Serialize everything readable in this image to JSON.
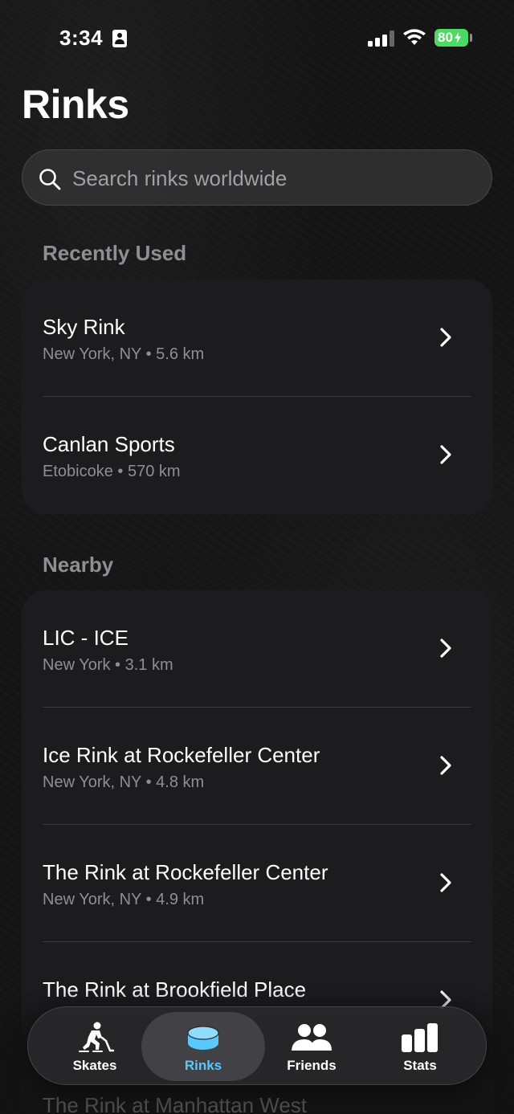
{
  "status_bar": {
    "time": "3:34",
    "battery": "80"
  },
  "title": "Rinks",
  "search": {
    "placeholder": "Search rinks worldwide"
  },
  "recently_used": {
    "title": "Recently Used",
    "items": [
      {
        "name": "Sky Rink",
        "location": "New York, NY",
        "distance": "5.6 km"
      },
      {
        "name": "Canlan Sports",
        "location": "Etobicoke",
        "distance": "570 km"
      }
    ]
  },
  "nearby": {
    "title": "Nearby",
    "items": [
      {
        "name": "LIC - ICE",
        "location": "New York",
        "distance": "3.1 km"
      },
      {
        "name": "Ice Rink at Rockefeller Center",
        "location": "New York, NY",
        "distance": "4.8 km"
      },
      {
        "name": "The Rink at Rockefeller Center",
        "location": "New York, NY",
        "distance": "4.9 km"
      },
      {
        "name": "The Rink at Brookfield Place",
        "location": "",
        "distance": ""
      },
      {
        "name": "The Rink at Manhattan West",
        "location": "",
        "distance": ""
      }
    ]
  },
  "tabs": [
    {
      "label": "Skates",
      "icon": "skater-icon",
      "active": false
    },
    {
      "label": "Rinks",
      "icon": "puck-icon",
      "active": true
    },
    {
      "label": "Friends",
      "icon": "friends-icon",
      "active": false
    },
    {
      "label": "Stats",
      "icon": "stats-icon",
      "active": false
    }
  ],
  "colors": {
    "background": "#141414",
    "card": "#1c1c1e",
    "accent": "#5ac8fa",
    "secondary_text": "#8e8e93",
    "battery": "#4cd964"
  }
}
